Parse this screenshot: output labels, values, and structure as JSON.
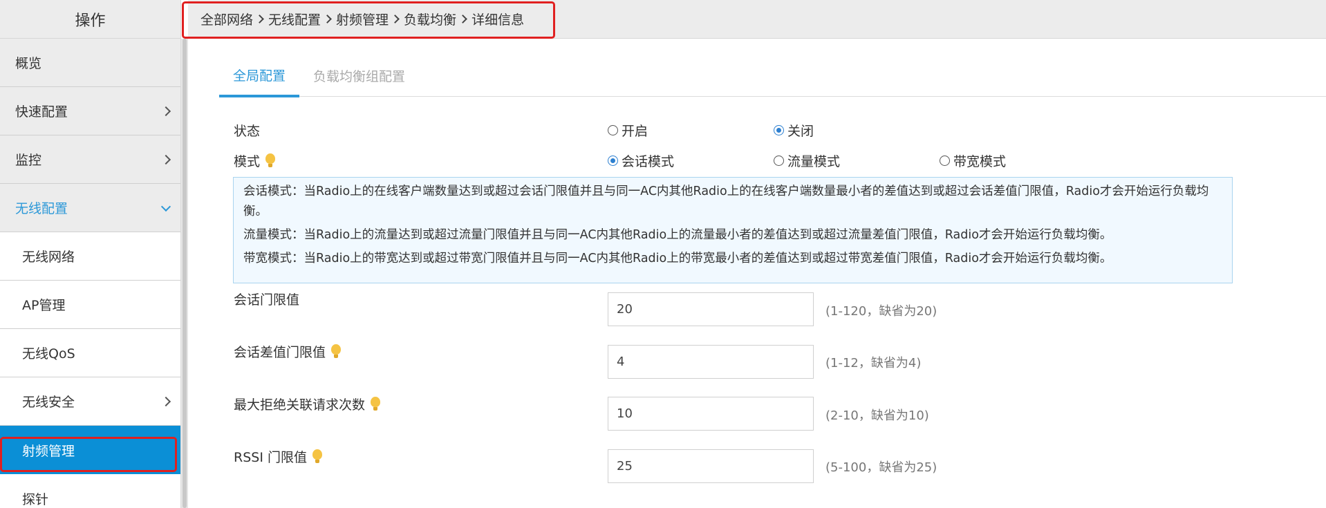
{
  "sidebar": {
    "title": "操作",
    "items": [
      {
        "label": "概览"
      },
      {
        "label": "快速配置"
      },
      {
        "label": "监控"
      },
      {
        "label": "无线配置"
      },
      {
        "label": "无线网络"
      },
      {
        "label": "AP管理"
      },
      {
        "label": "无线QoS"
      },
      {
        "label": "无线安全"
      },
      {
        "label": "射频管理"
      },
      {
        "label": "探针"
      }
    ]
  },
  "breadcrumb": [
    "全部网络",
    "无线配置",
    "射频管理",
    "负载均衡",
    "详细信息"
  ],
  "tabs": [
    {
      "label": "全局配置",
      "active": true
    },
    {
      "label": "负载均衡组配置",
      "active": false
    }
  ],
  "form": {
    "status": {
      "label": "状态",
      "options": [
        "开启",
        "关闭"
      ],
      "selected": "关闭"
    },
    "mode": {
      "label": "模式",
      "options": [
        "会话模式",
        "流量模式",
        "带宽模式"
      ],
      "selected": "会话模式"
    },
    "info": [
      "会话模式：当Radio上的在线客户端数量达到或超过会话门限值并且与同一AC内其他Radio上的在线客户端数量最小者的差值达到或超过会话差值门限值，Radio才会开始运行负载均衡。",
      "流量模式：当Radio上的流量达到或超过流量门限值并且与同一AC内其他Radio上的流量最小者的差值达到或超过流量差值门限值，Radio才会开始运行负载均衡。",
      "带宽模式：当Radio上的带宽达到或超过带宽门限值并且与同一AC内其他Radio上的带宽最小者的差值达到或超过带宽差值门限值，Radio才会开始运行负载均衡。"
    ],
    "fields": [
      {
        "label": "会话门限值",
        "value": "20",
        "hint": "(1-120，缺省为20)"
      },
      {
        "label": "会话差值门限值",
        "value": "4",
        "hint": "(1-12，缺省为4)"
      },
      {
        "label": "最大拒绝关联请求次数",
        "value": "10",
        "hint": "(2-10，缺省为10)"
      },
      {
        "label": "RSSI 门限值",
        "value": "25",
        "hint": "(5-100，缺省为25)"
      }
    ]
  },
  "colors": {
    "accent": "#2c98d8",
    "active_nav": "#0b8fd6",
    "highlight_box": "#e02020",
    "bulb": "#f5c343"
  }
}
